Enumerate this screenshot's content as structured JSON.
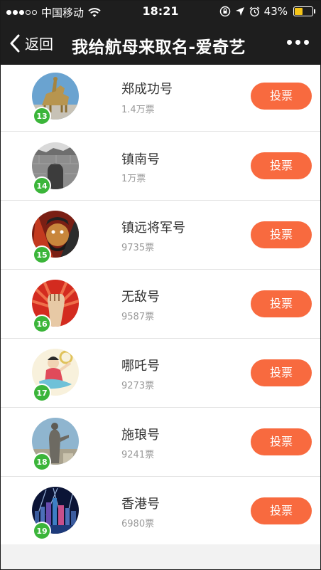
{
  "status_bar": {
    "carrier": "中国移动",
    "time": "18:21",
    "battery": "43%",
    "battery_level": 0.43
  },
  "nav": {
    "back_label": "返回",
    "title": "我给航母来取名-爱奇艺"
  },
  "items": [
    {
      "rank": "13",
      "name": "郑成功号",
      "votes": "1.4万票",
      "button": "投票"
    },
    {
      "rank": "14",
      "name": "镇南号",
      "votes": "1万票",
      "button": "投票"
    },
    {
      "rank": "15",
      "name": "镇远将军号",
      "votes": "9735票",
      "button": "投票"
    },
    {
      "rank": "16",
      "name": "无敌号",
      "votes": "9587票",
      "button": "投票"
    },
    {
      "rank": "17",
      "name": "哪吒号",
      "votes": "9273票",
      "button": "投票"
    },
    {
      "rank": "18",
      "name": "施琅号",
      "votes": "9241票",
      "button": "投票"
    },
    {
      "rank": "19",
      "name": "香港号",
      "votes": "6980票",
      "button": "投票"
    }
  ],
  "colors": {
    "vote_button": "#f86a3f",
    "rank_badge": "#3bb53a",
    "header": "#1e1e1e"
  }
}
